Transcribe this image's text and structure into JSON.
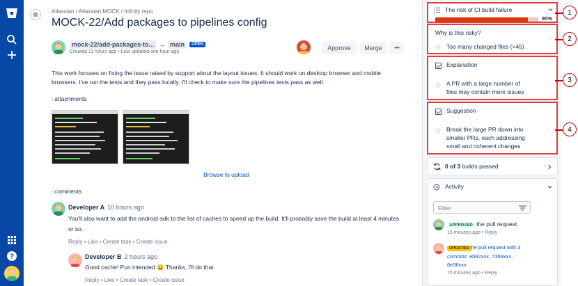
{
  "breadcrumb": [
    "Atlassian",
    "Atlassian MOCK",
    "Infinity repo"
  ],
  "breadcrumb_sep": "/",
  "pr": {
    "title": "MOCK-22/Add packages to pipelines config",
    "source_branch": "mock-22/add-packages-to...",
    "arrow": "→",
    "target_branch": "main",
    "status": "OPEN",
    "meta": "Created 11 hours ago • Last updated one hour ago",
    "approve_label": "Approve",
    "merge_label": "Merge",
    "more_label": "•••",
    "description": "This work focuses on fixing the issue raised by support about the layout issues. It should work on desktop browser and mobile browsers. I've run the tests and they pass locally. I'll check to make sure the pipelines tests pass as well.",
    "attachments_label": "attachments",
    "upload_label": "Browse to upload",
    "comments_label": "comments"
  },
  "comments": [
    {
      "author": "Developer A",
      "time": "10 hours ago",
      "text": "You'll also want to add the android-sdk to the list of caches to speed up the build. It'll probably save the build at least 4 minutes or so.",
      "actions": "Reply • Like • Create task • Create issue"
    },
    {
      "author": "Developer B",
      "time": "2 hours ago",
      "text": "Good cache! Pun intended 😀 Thanks, I'll do that.",
      "actions": "Reply • Like • Create task • Create issue"
    }
  ],
  "risk": {
    "title": "The risk of CI build failure",
    "percent_label": "90%",
    "percent": 90,
    "why_label": "Why is this risky?",
    "reason": "Too many changed files (>45)",
    "explanation_label": "Explanation",
    "explanation_lines": [
      "A PR with a large number of",
      "files  may contain more issues"
    ],
    "suggestion_label": "Suggestion",
    "suggestion_lines": [
      "Break the large PR down into",
      "smaller PRs, each addressing",
      "small and coherent changes"
    ]
  },
  "builds": {
    "count": "0 of 3",
    "label": "builds passed"
  },
  "activity": {
    "label": "Activity",
    "filter_placeholder": "Filter",
    "items": [
      {
        "badge": "APPROVED",
        "text": "the pull request",
        "time": "15 minutes ago • Reply"
      },
      {
        "badge": "UPDATED",
        "text_lines": [
          "he pull request with 3",
          "commits: eb92xxx, 73b9xxx,",
          "6e36xxx"
        ],
        "time": "15 minutes ago • Reply"
      }
    ]
  },
  "callouts": [
    "1",
    "2",
    "3",
    "4"
  ],
  "colors": {
    "nav": "#0747a6",
    "accent": "#0052cc",
    "risk": "#de350b",
    "callout": "#cc0000",
    "approved": "#36b37e",
    "updated": "#ffc400"
  }
}
